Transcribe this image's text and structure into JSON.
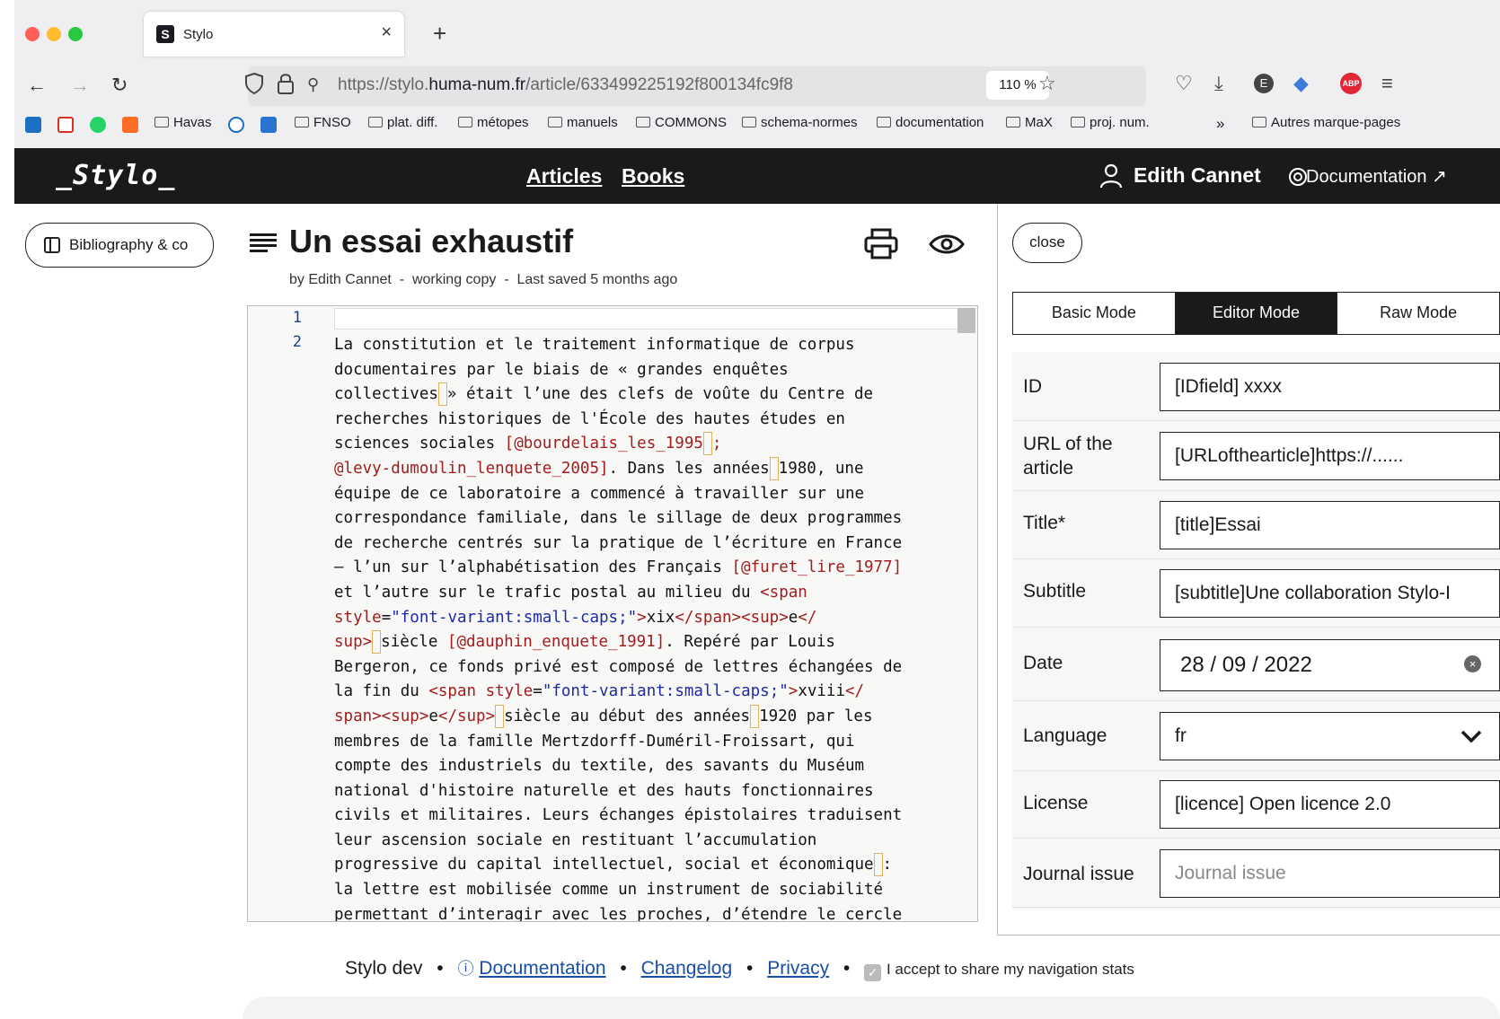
{
  "browser": {
    "tab_title": "Stylo",
    "tab_favicon": "S",
    "url_prefix": "https://stylo.",
    "url_domain": "huma-num.fr",
    "url_path": "/article/633499225192f800134fc9f8",
    "zoom": "110 %",
    "bookmarks": [
      "Havas",
      "FNSO",
      "plat. diff.",
      "métopes",
      "manuels",
      "COMMONS",
      "schema-normes",
      "documentation",
      "MaX",
      "proj. num."
    ],
    "other_bookmarks": "Autres marque-pages"
  },
  "app": {
    "logo": "_Stylo_",
    "nav": {
      "articles": "Articles",
      "books": "Books"
    },
    "user_name": "Edith Cannet",
    "documentation": "Documentation ↗"
  },
  "article": {
    "biblio_button": "Bibliography & co",
    "title": "Un essai exhaustif",
    "meta_by": "by Edith Cannet",
    "meta_sep": "-",
    "meta_status": "working copy",
    "meta_saved": "Last saved 5 months ago",
    "line_numbers": [
      "1",
      "2"
    ]
  },
  "panel": {
    "close_label": "close",
    "modes": [
      "Basic Mode",
      "Editor Mode",
      "Raw Mode"
    ],
    "active_mode": "Editor Mode",
    "fields": {
      "id": {
        "label": "ID",
        "value": "[IDfield] xxxx"
      },
      "url": {
        "label": "URL of the article",
        "value": "[URLofthearticle]https://......"
      },
      "title": {
        "label": "Title*",
        "value": "[title]Essai"
      },
      "subtitle": {
        "label": "Subtitle",
        "value": "[subtitle]Une collaboration Stylo-I"
      },
      "date": {
        "label": "Date",
        "value": "28 / 09 / 2022"
      },
      "language": {
        "label": "Language",
        "value": "fr"
      },
      "license": {
        "label": "License",
        "value": "[licence] Open licence 2.0"
      },
      "journal": {
        "label": "Journal issue",
        "placeholder": "Journal issue"
      }
    }
  },
  "footer": {
    "env": "Stylo dev",
    "documentation": "Documentation",
    "changelog": "Changelog",
    "privacy": "Privacy",
    "consent": "I accept to share my navigation stats"
  },
  "colors": {
    "header_bg": "#1a1a1a",
    "citation": "#a11d1d",
    "string": "#1d2aa6",
    "link": "#1a4fa8"
  }
}
